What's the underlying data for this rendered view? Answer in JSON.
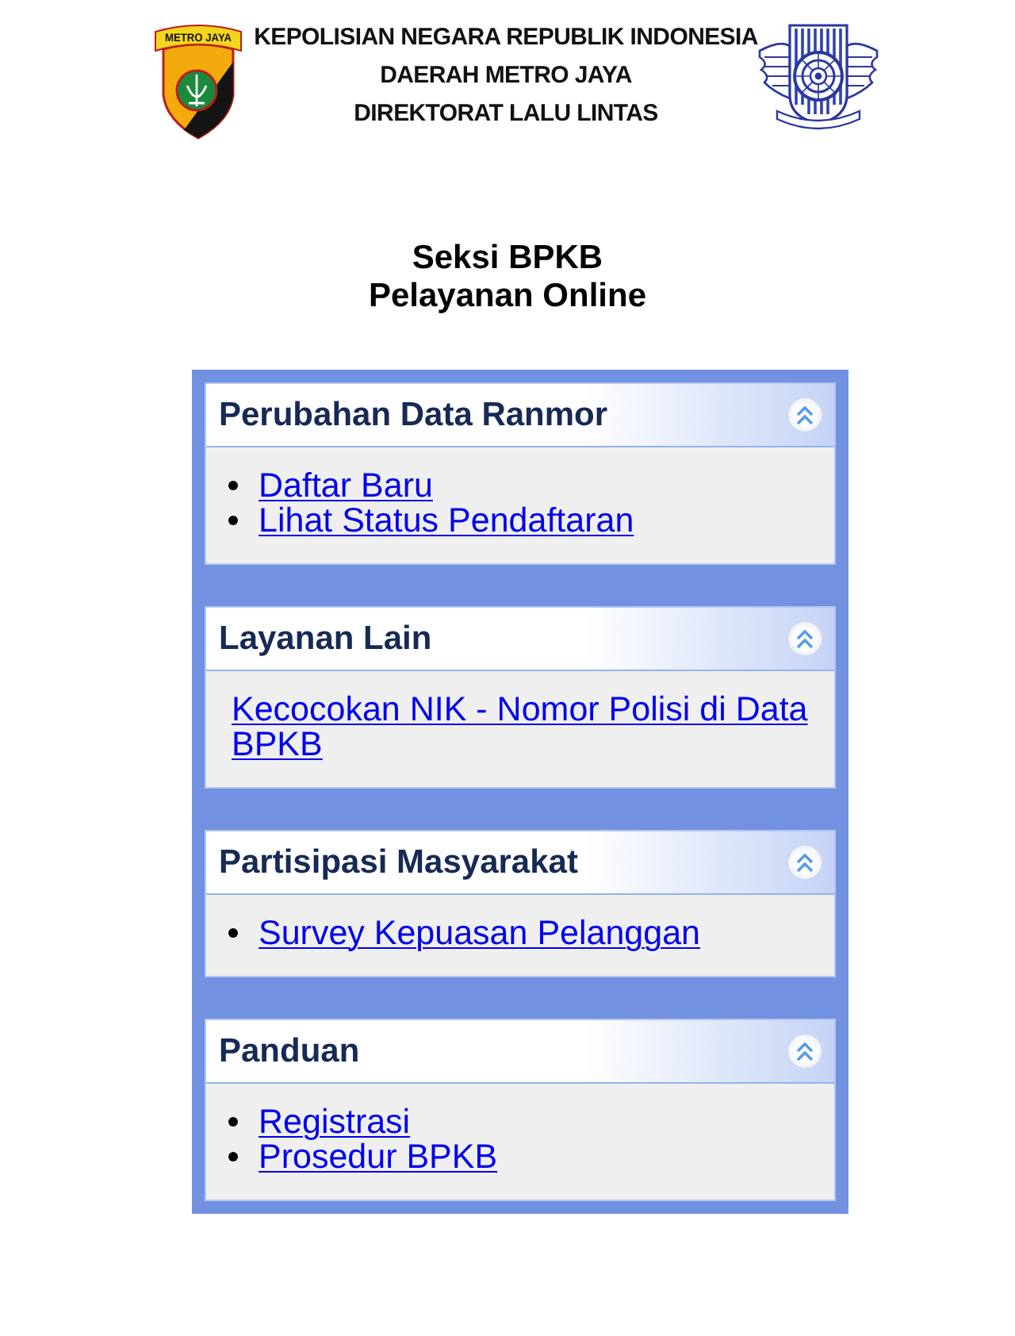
{
  "header": {
    "badge_text": "METRO JAYA",
    "lines": [
      "KEPOLISIAN NEGARA REPUBLIK INDONESIA",
      "DAERAH METRO JAYA",
      "DIREKTORAT LALU LINTAS"
    ]
  },
  "page_title": [
    "Seksi BPKB",
    "Pelayanan Online"
  ],
  "sections": [
    {
      "title": "Perubahan Data Ranmor",
      "expanded": true,
      "kind": "bulleted",
      "links": [
        "Daftar Baru",
        "Lihat Status Pendaftaran"
      ]
    },
    {
      "title": "Layanan Lain",
      "expanded": true,
      "kind": "plain",
      "links": [
        "Kecocokan NIK - Nomor Polisi di Data BPKB"
      ]
    },
    {
      "title": "Partisipasi Masyarakat",
      "expanded": true,
      "kind": "bulleted",
      "links": [
        "Survey Kepuasan Pelanggan"
      ]
    },
    {
      "title": "Panduan",
      "expanded": true,
      "kind": "bulleted",
      "links": [
        "Registrasi",
        "Prosedur BPKB"
      ]
    }
  ]
}
